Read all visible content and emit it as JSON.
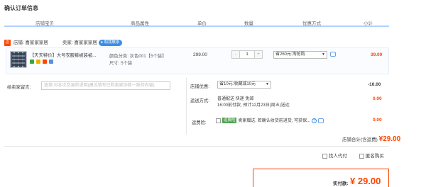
{
  "page": {
    "title": "确认订单信息"
  },
  "table_header": [
    "店铺宝贝",
    "商品属性",
    "单价",
    "数量",
    "优惠方式",
    "小计"
  ],
  "shop": {
    "icon_text": "店",
    "label": "店铺: 喜家家家居",
    "seller": "卖家: 喜家家家居",
    "chat": "和我联系"
  },
  "item": {
    "title": "【天天特价】大号衣服裤被装被...",
    "attr_color": "颜色分类: 灰色001【5个装】",
    "attr_size": "尺寸: 5个装",
    "price": "299.00",
    "qty": "1",
    "qty_minus": "-",
    "qty_plus": "+",
    "discount": "省260元:淘抢购",
    "subtotal": "39.00"
  },
  "message": {
    "label": "给卖家留言:",
    "placeholder": "选填:对本次交易的说明(建议填写已和卖家协商一致的内容)"
  },
  "shop_discount": {
    "label": "店铺优惠:",
    "value": "省10元:收藏减10元",
    "amount": "-10.00"
  },
  "shipping": {
    "label": "运送方式:",
    "line1": "普通配送 快递 免邮",
    "line2": "16:00前付款, 预计12月23日(周五)送达",
    "amount": "0.00"
  },
  "insurance": {
    "label": "运费险:",
    "badge": "运费险",
    "text": "卖家赠送, 若确认收货前退货, 可获保...",
    "help": "?",
    "amount": "0.00"
  },
  "shop_total": {
    "label": "店铺合计(含运费)",
    "currency": "¥",
    "amount": "29.00"
  },
  "options": {
    "friend_pay": "找人代付",
    "anonymous": "匿名购买"
  },
  "payment": {
    "label": "实付款:",
    "currency": "¥",
    "amount": "29.00"
  },
  "colors": {
    "accent": "#ff4400",
    "header_line": "#b2d1ff",
    "link_blue": "#3a8ee6"
  }
}
